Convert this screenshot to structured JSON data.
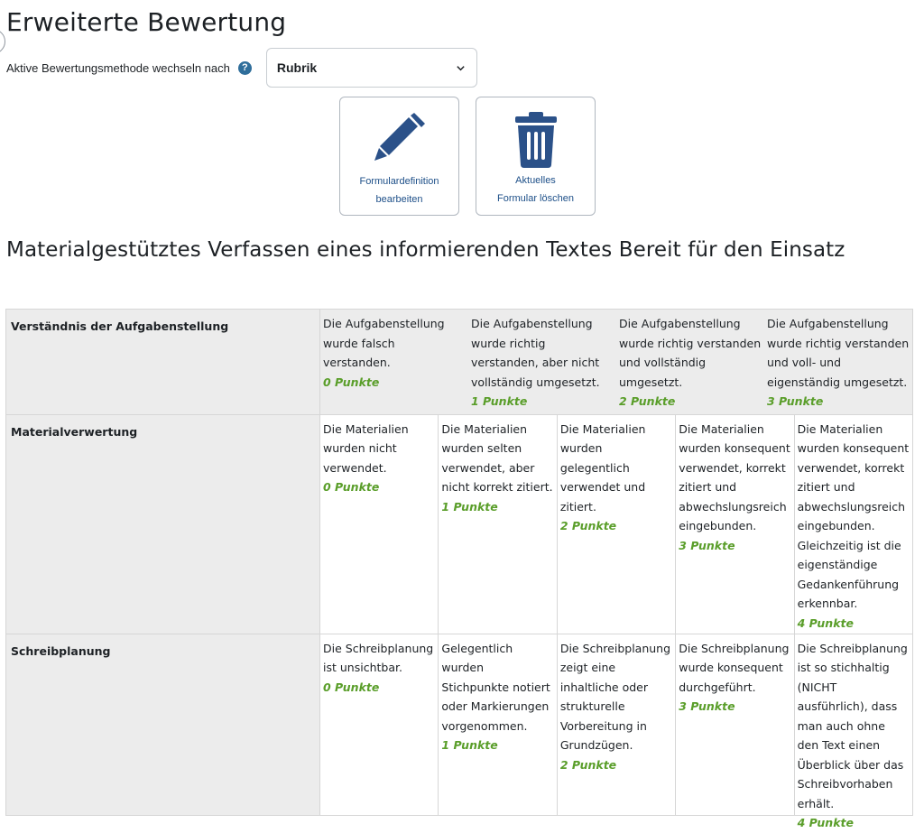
{
  "page": {
    "heading": "Erweiterte Bewertung",
    "method_label": "Aktive Bewertungsmethode wechseln nach",
    "help_icon": "question-circle-icon",
    "method_select": {
      "selected": "Rubrik"
    }
  },
  "actions": [
    {
      "label_line1": "Formulardefinition",
      "label_line2": "bearbeiten",
      "icon": "pencil-icon"
    },
    {
      "label_line1": "Aktuelles",
      "label_line2": "Formular löschen",
      "icon": "trash-icon"
    }
  ],
  "colors": {
    "accent": "#1d4f88",
    "points": "#5a9e2a",
    "help": "#2f6e9b"
  },
  "rubric": {
    "title": "Materialgestütztes Verfassen eines informierenden Textes Bereit für den Einsatz",
    "criteria": [
      {
        "name": "Verständnis der Aufgabenstellung",
        "levels": [
          {
            "text": "Die Aufgabenstellung wurde falsch verstanden.",
            "points": "0 Punkte"
          },
          {
            "text": "Die Aufgabenstellung wurde richtig verstanden, aber nicht vollständig umgesetzt.",
            "points": "1 Punkte"
          },
          {
            "text": "Die Aufgabenstellung wurde richtig verstanden und vollständig umgesetzt.",
            "points": "2 Punkte"
          },
          {
            "text": "Die Aufgabenstellung wurde richtig verstanden und voll- und eigenständig umgesetzt.",
            "points": "3 Punkte"
          }
        ]
      },
      {
        "name": "Materialverwertung",
        "levels": [
          {
            "text": "Die Materialien wurden nicht verwendet.",
            "points": "0 Punkte"
          },
          {
            "text": "Die Materialien wurden selten verwendet, aber nicht korrekt zitiert.",
            "points": "1 Punkte"
          },
          {
            "text": "Die Materialien wurden gelegentlich verwendet und zitiert.",
            "points": "2 Punkte"
          },
          {
            "text": "Die Materialien wurden konsequent verwendet, korrekt zitiert und abwechslungsreich eingebunden.",
            "points": "3 Punkte"
          },
          {
            "text": "Die Materialien wurden konsequent verwendet, korrekt zitiert und abwechslungsreich eingebunden. Gleichzeitig ist die eigenständige Gedankenführung erkennbar.",
            "points": "4 Punkte"
          }
        ]
      },
      {
        "name": "Schreibplanung",
        "levels": [
          {
            "text": "Die Schreibplanung ist unsichtbar.",
            "points": "0 Punkte"
          },
          {
            "text": "Gelegentlich wurden Stichpunkte notiert oder Markierungen vorgenommen.",
            "points": "1 Punkte"
          },
          {
            "text": "Die Schreibplanung zeigt eine inhaltliche oder strukturelle Vorbereitung in Grundzügen.",
            "points": "2 Punkte"
          },
          {
            "text": "Die Schreibplanung wurde konsequent durchgeführt.",
            "points": "3 Punkte"
          },
          {
            "text": "Die Schreibplanung ist so stichhaltig (NICHT ausführlich), dass man auch ohne den Text einen Überblick über das Schreibvorhaben erhält.",
            "points": "4 Punkte"
          }
        ]
      }
    ]
  }
}
